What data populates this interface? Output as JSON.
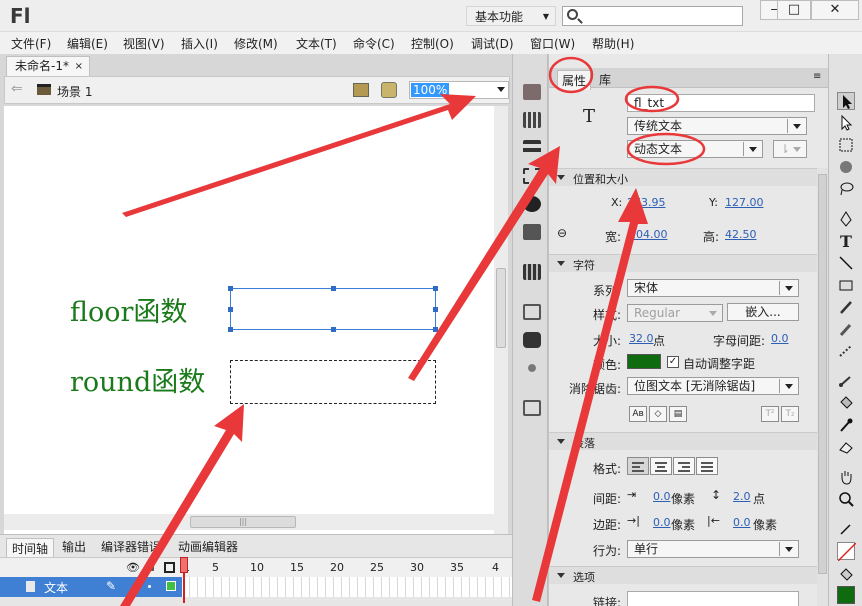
{
  "app": {
    "logo": "Fl",
    "workspace": "基本功能",
    "window_controls": {
      "minimize": "—",
      "maximize": "□",
      "close": "✕"
    }
  },
  "menu": [
    "文件(F)",
    "编辑(E)",
    "视图(V)",
    "插入(I)",
    "修改(M)",
    "文本(T)",
    "命令(C)",
    "控制(O)",
    "调试(D)",
    "窗口(W)",
    "帮助(H)"
  ],
  "document": {
    "tab": "未命名-1*",
    "tab_close": "×",
    "scene": "场景 1",
    "zoom": "100%"
  },
  "stage": {
    "label_floor": "floor函数",
    "label_round": "round函数"
  },
  "timeline": {
    "tabs": [
      "时间轴",
      "输出",
      "编译器错误",
      "动画编辑器"
    ],
    "layer_name": "文本",
    "frame_numbers": [
      "1",
      "5",
      "10",
      "15",
      "20",
      "25",
      "30",
      "35",
      "4"
    ]
  },
  "properties": {
    "tabs": [
      "属性",
      "库"
    ],
    "type_icon": "T",
    "instance_name": "fl_txt",
    "text_engine": "传统文本",
    "text_type": "动态文本",
    "position_size": {
      "header": "位置和大小",
      "x_label": "X:",
      "x_value": "273.95",
      "y_label": "Y:",
      "y_value": "127.00",
      "w_label": "宽:",
      "w_value": "204.00",
      "h_label": "高:",
      "h_value": "42.50"
    },
    "character": {
      "header": "字符",
      "family_label": "系列:",
      "family_value": "宋体",
      "style_label": "样式:",
      "style_value": "Regular",
      "embed_button": "嵌入...",
      "size_label": "大小:",
      "size_value": "32.0",
      "size_unit": "点",
      "letter_spacing_label": "字母间距:",
      "letter_spacing_value": "0.0",
      "color_label": "颜色:",
      "text_color": "#0e6b10",
      "autokern_label": "自动调整字距",
      "autokern_checked": true,
      "antialias_label": "消除锯齿:",
      "antialias_value": "位图文本 [无消除锯齿]",
      "sup_button": "T²",
      "sub_button": "T₂"
    },
    "paragraph": {
      "header": "段落",
      "format_label": "格式:",
      "spacing_label": "间距:",
      "indent_value": "0.0",
      "indent_unit": "像素",
      "line_spacing_value": "2.0",
      "line_spacing_unit": "点",
      "margins_label": "边距:",
      "left_margin_value": "0.0",
      "left_margin_unit": "像素",
      "right_margin_value": "0.0",
      "right_margin_unit": "像素",
      "behavior_label": "行为:",
      "behavior_value": "单行"
    },
    "options": {
      "header": "选项",
      "link_label": "链接:"
    }
  },
  "colors": {
    "accent_blue": "#3399ff",
    "annotation_red": "#e8383a",
    "stage_text_green": "#1b7a1b"
  }
}
